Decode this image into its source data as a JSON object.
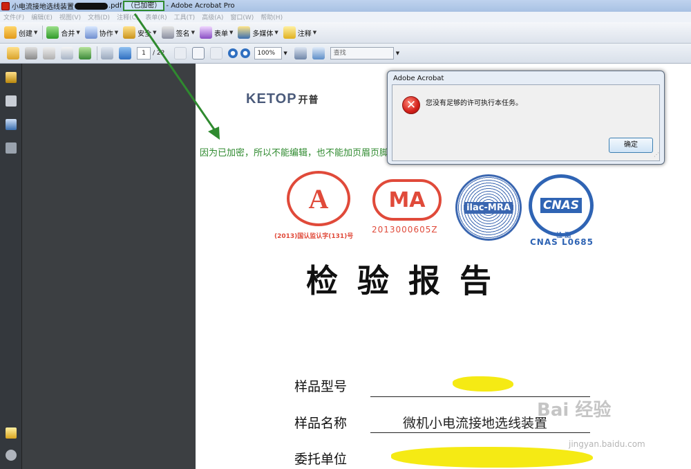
{
  "window": {
    "title_prefix": "小电流接地选线装置",
    "title_ext": ".pdf",
    "encrypted_tag": "（已加密）",
    "title_suffix": "- Adobe Acrobat Pro"
  },
  "menu": [
    "文件(F)",
    "编辑(E)",
    "视图(V)",
    "文档(D)",
    "注释(C)",
    "表单(R)",
    "工具(T)",
    "高级(A)",
    "窗口(W)",
    "帮助(H)"
  ],
  "toolbar": {
    "create": "创建",
    "combine": "合并",
    "collaborate": "协作",
    "secure": "安全",
    "sign": "签名",
    "forms": "表单",
    "multimedia": "多媒体",
    "comment": "注释"
  },
  "navigation": {
    "current_page": "1",
    "total_pages": "/ 22",
    "zoom": "100%",
    "find_placeholder": "查找"
  },
  "document": {
    "logo_text": "KETOP",
    "logo_cn": "开普",
    "annotation": "因为已加密，所以不能编辑，也不能加页眉页脚",
    "seal_cma_number": "2013000605Z",
    "seal_cal_caption": "(2013)国认监认字(131)号",
    "cnas_sub": "检 测",
    "cnas_number": "CNAS L0685",
    "report_title": "检验报告",
    "fields": [
      {
        "label": "样品型号",
        "value": ""
      },
      {
        "label": "样品名称",
        "value": "微机小电流接地选线装置"
      },
      {
        "label": "委托单位",
        "value": ""
      }
    ]
  },
  "dialog": {
    "title": "Adobe Acrobat",
    "message": "您没有足够的许可执行本任务。",
    "ok": "确定"
  },
  "watermark": {
    "text": "Bai 经验",
    "url": "jingyan.baidu.com"
  },
  "colors": {
    "annotation_green": "#2f8a2f",
    "seal_red": "#e04a3a",
    "seal_blue": "#2f64b4",
    "highlight_yellow": "#f5ea14"
  }
}
